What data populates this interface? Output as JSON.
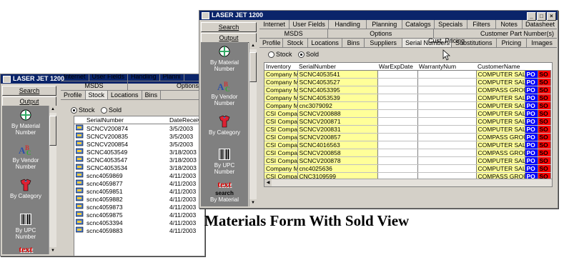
{
  "window_title": "LASER JET 1200",
  "sidebar": {
    "search_label": "Search",
    "output_label": "Output",
    "icons": [
      {
        "label_line1": "By Material",
        "label_line2": "Number"
      },
      {
        "label_line1": "By Vendor",
        "label_line2": "Number"
      },
      {
        "label_line1": "By Category",
        "label_line2": ""
      },
      {
        "label_line1": "By UPC",
        "label_line2": "Number"
      },
      {
        "label_line1": "text",
        "label_line2": "search"
      },
      {
        "label_line1": "By Material",
        "label_line2": ""
      }
    ]
  },
  "tabs": {
    "row1": [
      "Internet",
      "User Fields",
      "Handling",
      "Planning",
      "Catalogs",
      "Specials",
      "Filters",
      "Notes",
      "Datasheet"
    ],
    "row2": [
      "MSDS",
      "Options",
      "Cust. Pricing",
      "Customer Part Number(s)"
    ],
    "row3": [
      "Profile",
      "Stock",
      "Locations",
      "Bins",
      "Suppliers",
      "Serial Numbers",
      "Substitutions",
      "Pricing",
      "Images"
    ],
    "left_row1": [
      "Internet",
      "User Fields",
      "Handling",
      "Planni"
    ],
    "left_row2": [
      "MSDS",
      "Options"
    ],
    "left_row3": [
      "Profile",
      "Stock",
      "Locations",
      "Bins"
    ]
  },
  "radio": {
    "stock_label": "Stock",
    "sold_label": "Sold"
  },
  "left_grid": {
    "columns": [
      "SerialNumber",
      "DateReceive"
    ],
    "rows": [
      [
        "SCNCV200874",
        "3/5/2003"
      ],
      [
        "SCNCV200835",
        "3/5/2003"
      ],
      [
        "SCNCV200854",
        "3/5/2003"
      ],
      [
        "SCNC4053549",
        "3/18/2003"
      ],
      [
        "SCNC4053547",
        "3/18/2003"
      ],
      [
        "SCNC4053534",
        "3/18/2003"
      ],
      [
        "scnc4059869",
        "4/11/2003"
      ],
      [
        "scnc4059877",
        "4/11/2003"
      ],
      [
        "scnc4059851",
        "4/11/2003"
      ],
      [
        "scnc4059882",
        "4/11/2003"
      ],
      [
        "scnc4059873",
        "4/11/2003"
      ],
      [
        "scnc4059875",
        "4/11/2003"
      ],
      [
        "scnc4053394",
        "4/11/2003"
      ],
      [
        "scnc4059883",
        "4/11/2003"
      ]
    ]
  },
  "right_grid": {
    "columns": [
      "Inventory",
      "SerialNumber",
      "WarExpDate",
      "WarrantyNum",
      "CustomerName",
      "",
      ""
    ],
    "rows": [
      [
        "Company M",
        "SCNC4053541",
        "",
        "",
        "COMPUTER SALE",
        "PO",
        "SO"
      ],
      [
        "Company M",
        "SCNC4053527",
        "",
        "",
        "COMPUTER SALE",
        "PO",
        "SO"
      ],
      [
        "Company M",
        "SCNC4053395",
        "",
        "",
        "COMPASS GROUI",
        "PO",
        "SO"
      ],
      [
        "Company M",
        "SCNC4053539",
        "",
        "",
        "COMPUTER SALE",
        "PO",
        "SO"
      ],
      [
        "Company M",
        "cnc3079092",
        "",
        "",
        "COMPUTER SALE",
        "PO",
        "SO"
      ],
      [
        "CSI Compas",
        "SCNCV200888",
        "",
        "",
        "COMPUTER SALE",
        "PO",
        "SO"
      ],
      [
        "CSI Compas",
        "SCNCV200871",
        "",
        "",
        "COMPUTER SALE",
        "PO",
        "SO"
      ],
      [
        "CSI Compas",
        "SCNCV200831",
        "",
        "",
        "COMPUTER SALE",
        "PO",
        "SO"
      ],
      [
        "CSI Compas",
        "SCNCV200857",
        "",
        "",
        "COMPASS GROUI",
        "PO",
        "SO"
      ],
      [
        "CSI Compas",
        "SCNC4016563",
        "",
        "",
        "COMPUTER SALE",
        "PO",
        "SO"
      ],
      [
        "CSI Compas",
        "SCNCV200858",
        "",
        "",
        "COMPASS GROUI",
        "PO",
        "SO"
      ],
      [
        "CSI Compas",
        "SCNCV200878",
        "",
        "",
        "COMPUTER SALE",
        "PO",
        "SO"
      ],
      [
        "Company M",
        "cnc4025636",
        "",
        "",
        "COMPUTER SALE",
        "PO",
        "SO"
      ],
      [
        "CSI Compas",
        "CNC3109599",
        "",
        "",
        "COMPASS GROUI",
        "PO",
        "SO"
      ]
    ]
  },
  "caption": "Materials Form With Sold View",
  "colors": {
    "title_bar": "#0a246a",
    "yellow_cell": "#ffff99",
    "po_cell": "#0000ff",
    "so_cell": "#ff0000",
    "icon_pane": "#808080"
  }
}
